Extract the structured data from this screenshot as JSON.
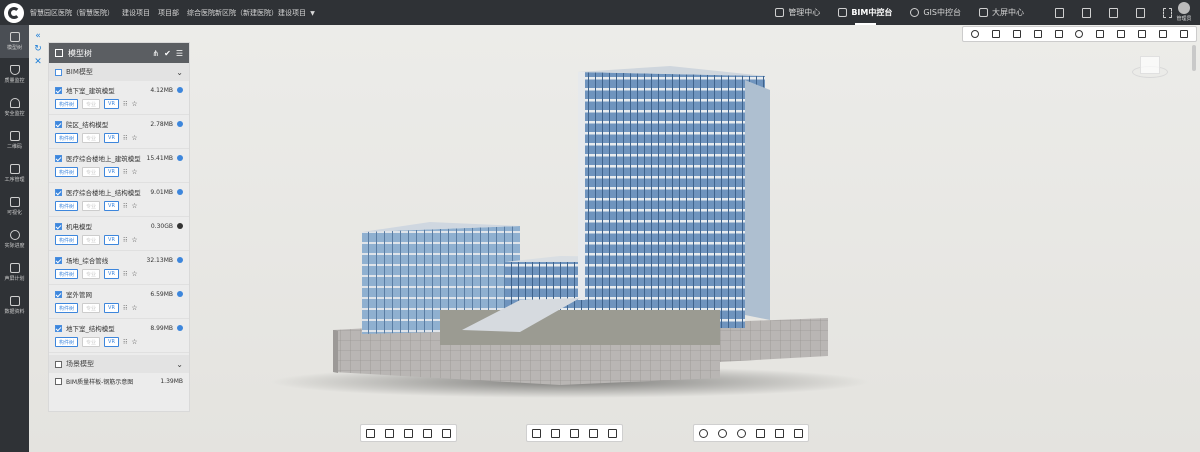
{
  "topbar": {
    "breadcrumbs": [
      {
        "label": "智慧园区医院（智慧医院）"
      },
      {
        "label": "建设项目"
      },
      {
        "label": "项目部"
      },
      {
        "label": "综合医院新区院（新建医院）建设项目",
        "has_dropdown": true
      }
    ],
    "nav": [
      {
        "label": "管理中心",
        "icon": "grid-icon",
        "active": false
      },
      {
        "label": "BIM中控台",
        "icon": "cube-icon",
        "active": true
      },
      {
        "label": "GIS中控台",
        "icon": "globe-icon",
        "active": false
      },
      {
        "label": "大屏中心",
        "icon": "screen-icon",
        "active": false
      }
    ],
    "right_icons": [
      "monitor-icon",
      "document-icon",
      "tablet-icon",
      "device-icon",
      "fullscreen-icon"
    ],
    "user": {
      "name": "管理员"
    }
  },
  "rail": [
    {
      "label": "模型树",
      "icon": "model-icon",
      "active": true
    },
    {
      "label": "质量监控",
      "icon": "shield-icon",
      "active": false
    },
    {
      "label": "安全监控",
      "icon": "cloud-icon",
      "active": false
    },
    {
      "label": "二维码",
      "icon": "qrcode-icon",
      "active": false
    },
    {
      "label": "工序管理",
      "icon": "process-icon",
      "active": false
    },
    {
      "label": "可视化",
      "icon": "visual-icon",
      "active": false
    },
    {
      "label": "实际进度",
      "icon": "clock-icon",
      "active": false
    },
    {
      "label": "声屏计划",
      "icon": "plan-icon",
      "active": false
    },
    {
      "label": "数据资料",
      "icon": "archive-icon",
      "active": false
    }
  ],
  "panel": {
    "title": "模型树",
    "group1": {
      "label": "BIM模型"
    },
    "models": [
      {
        "name": "地下室_建筑模型",
        "size": "4.12MB",
        "visible": true
      },
      {
        "name": "院区_结构模型",
        "size": "2.78MB",
        "visible": true
      },
      {
        "name": "医疗综合楼地上_建筑模型",
        "size": "15.41MB",
        "visible": true
      },
      {
        "name": "医疗综合楼地上_结构模型",
        "size": "9.01MB",
        "visible": true
      },
      {
        "name": "机电模型",
        "size": "0.30GB",
        "visible": false
      },
      {
        "name": "场地_综合管线",
        "size": "32.13MB",
        "visible": true
      },
      {
        "name": "室外管网",
        "size": "6.59MB",
        "visible": true
      },
      {
        "name": "地下室_结构模型",
        "size": "8.99MB",
        "visible": true
      }
    ],
    "btn_a": "构件树",
    "btn_b": "专业",
    "btn_c": "VR",
    "group2": {
      "label": "场景模型"
    },
    "sub_item": {
      "name": "BIM质量样板-钢筋示意图",
      "size": "1.39MB"
    }
  },
  "right_toolbar": [
    "compass-icon",
    "cube-icon",
    "layers-icon",
    "image-icon",
    "attach-icon",
    "gear-icon",
    "star-icon",
    "list-icon",
    "flag-icon",
    "filter-icon",
    "check-icon"
  ],
  "bottom_toolbar_1": [
    "person-icon",
    "camera-icon",
    "pentagon-icon",
    "box-icon",
    "tree-icon"
  ],
  "bottom_toolbar_2": [
    "section-box-icon",
    "measure-icon",
    "fit-icon",
    "frame-icon",
    "document-icon"
  ],
  "bottom_toolbar_3": [
    "settings-icon",
    "eye-slash-icon",
    "eye-icon",
    "layers-icon",
    "focus-icon",
    "edit-icon"
  ]
}
